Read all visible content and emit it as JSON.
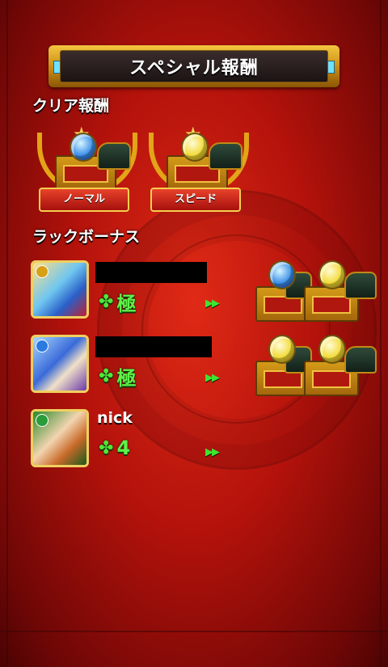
{
  "header": {
    "title": "スペシャル報酬"
  },
  "clear_reward": {
    "section_title": "クリア報酬",
    "items": [
      {
        "label": "ノーマル",
        "gem": "blue-gem-icon",
        "color": "#3c8ee8"
      },
      {
        "label": "スピード",
        "gem": "yellow-gem-icon",
        "color": "#f2da36"
      }
    ]
  },
  "luck_bonus": {
    "section_title": "ラックボーナス",
    "rows": [
      {
        "name": "",
        "luck": "極",
        "arrows": "≫",
        "rewards": [
          "blue",
          "yellow"
        ]
      },
      {
        "name": "",
        "luck": "極",
        "arrows": "≫",
        "rewards": [
          "yellow",
          "yellow"
        ]
      },
      {
        "name": "nick",
        "luck": "4",
        "arrows": "≫",
        "rewards": []
      }
    ]
  },
  "colors": {
    "luck_green": "#5ff24a",
    "frame_gold": "#e3a418",
    "background_red": "#b3120b"
  }
}
